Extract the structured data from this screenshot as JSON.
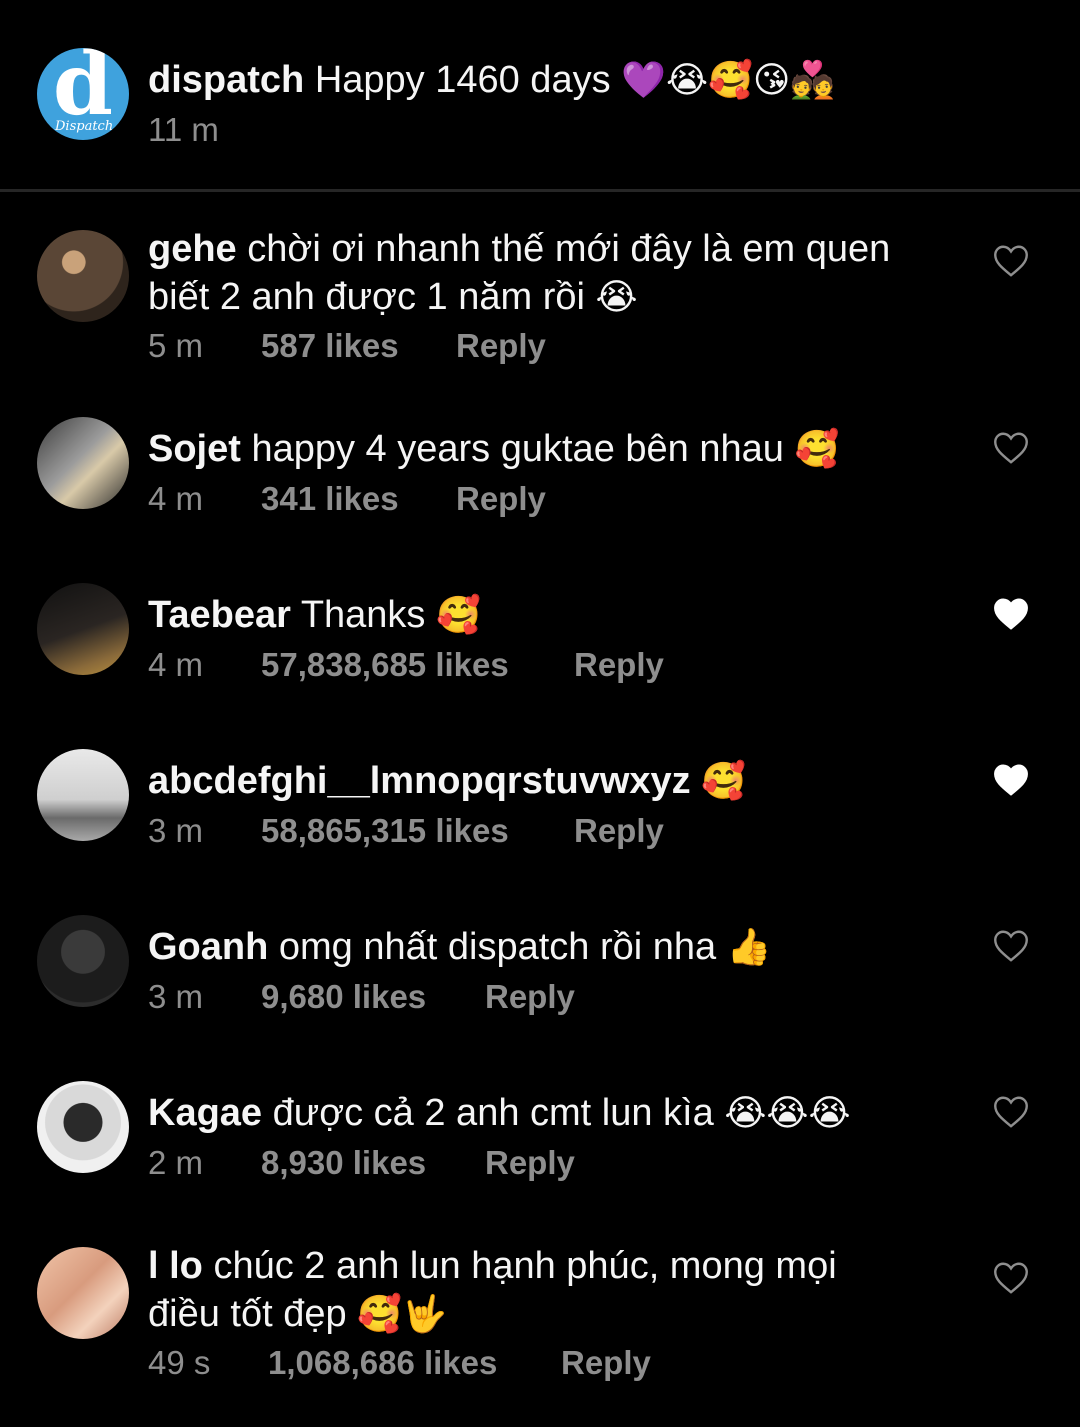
{
  "caption": {
    "username": "dispatch",
    "text": "Happy 1460 days",
    "emojis": "💜😭🥰😘💑",
    "time": "11 m",
    "avatar_logo": "d",
    "avatar_logo_sub": "Dispatch"
  },
  "comments": [
    {
      "username": "gehe",
      "text_line1": "chời ơi nhanh thế mới đây là em quen",
      "text_line2": "biết 2 anh được 1 năm rồi",
      "emojis": "😭",
      "time": "5 m",
      "likes": "587 likes",
      "reply": "Reply",
      "liked": false
    },
    {
      "username": "Sojet",
      "text_line1": "happy 4 years guktae bên nhau",
      "emojis": "🥰",
      "time": "4 m",
      "likes": "341 likes",
      "reply": "Reply",
      "liked": false
    },
    {
      "username": "Taebear",
      "text_line1": "Thanks",
      "emojis": "🥰",
      "time": "4 m",
      "likes": "57,838,685 likes",
      "reply": "Reply",
      "liked": true
    },
    {
      "username": "abcdefghi__lmnopqrstuvwxyz",
      "text_line1": "",
      "emojis": "🥰",
      "time": "3 m",
      "likes": "58,865,315 likes",
      "reply": "Reply",
      "liked": true
    },
    {
      "username": "Goanh",
      "text_line1": "omg nhất dispatch rồi nha",
      "emojis": "👍",
      "time": "3 m",
      "likes": "9,680 likes",
      "reply": "Reply",
      "liked": false
    },
    {
      "username": "Kagae",
      "text_line1": "được cả 2 anh cmt lun kìa",
      "emojis": "😭😭😭",
      "time": "2 m",
      "likes": "8,930 likes",
      "reply": "Reply",
      "liked": false
    },
    {
      "username": "l lo",
      "text_line1": "chúc 2 anh lun hạnh phúc, mong mọi",
      "text_line2": "điều tốt đẹp",
      "emojis": "🥰🤟",
      "time": "49 s",
      "likes": "1,068,686 likes",
      "reply": "Reply",
      "liked": true
    }
  ],
  "icons": {
    "heart_outline": "heart-outline-icon",
    "heart_filled": "heart-filled-icon"
  },
  "colors": {
    "background": "#000000",
    "text": "#f5f5f5",
    "secondary": "#8e8e8e",
    "avatar_brand": "#3fa2dd"
  }
}
